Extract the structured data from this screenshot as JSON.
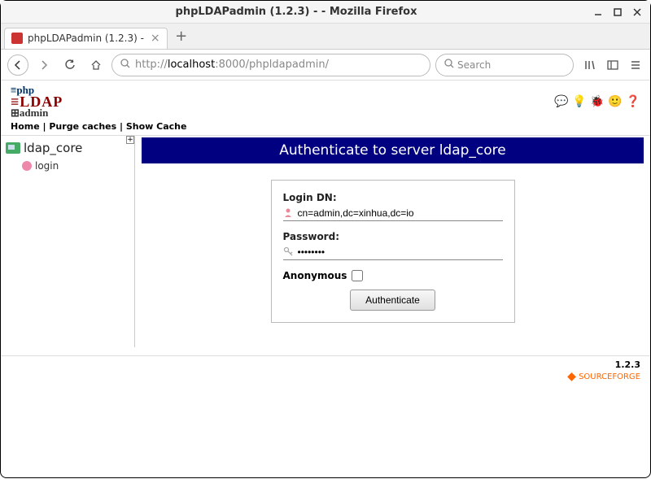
{
  "window": {
    "title": "phpLDAPadmin (1.2.3) - - Mozilla Firefox"
  },
  "tab": {
    "label": "phpLDAPadmin (1.2.3) -"
  },
  "url": {
    "prefix": "http://",
    "host": "localhost",
    "rest": ":8000/phpldapadmin/"
  },
  "search": {
    "placeholder": "Search"
  },
  "logo": {
    "l1": "php",
    "l2": "LDAP",
    "l3": "admin"
  },
  "links": {
    "home": "Home",
    "sep": " | ",
    "purge": "Purge caches",
    "show": "Show Cache"
  },
  "sidebar": {
    "server": "ldap_core",
    "login": "login",
    "expand": "+"
  },
  "main": {
    "title": "Authenticate to server ldap_core",
    "login_dn_label": "Login DN:",
    "login_dn_value": "cn=admin,dc=xinhua,dc=io",
    "password_label": "Password:",
    "password_value": "••••••••",
    "anonymous_label": "Anonymous",
    "button": "Authenticate"
  },
  "footer": {
    "version": "1.2.3",
    "sourceforge": "SOURCEFORGE"
  }
}
